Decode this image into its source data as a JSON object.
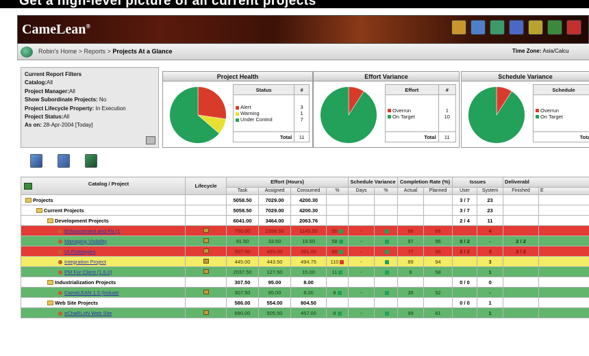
{
  "caption": "Get a high-level picture of all current projects",
  "app": {
    "logo": "CameLean",
    "logo_mark": "®"
  },
  "toolbar_icons": [
    "report-icon",
    "globe-icon",
    "eye-icon",
    "network-icon",
    "gear-icon",
    "shield-icon",
    "help-icon"
  ],
  "toolbar_colors": [
    "#c9962e",
    "#4f7fc9",
    "#3f9a6a",
    "#4a68c4",
    "#b8a22e",
    "#3b8a3b",
    "#c43030"
  ],
  "nav": {
    "crumbs": [
      "Robin's Home",
      "Reports",
      "Projects At a Glance"
    ],
    "separator": ">",
    "timezone_label": "Time Zone:",
    "timezone_value": "Asia/Calcu"
  },
  "filters": {
    "title": "Current Report Filters",
    "rows": [
      {
        "label": "Catalog:",
        "value": "All"
      },
      {
        "label": "Project Manager:",
        "value": "All"
      },
      {
        "label": "Show Subordinate Projects:",
        "value": "No"
      },
      {
        "label": "Project Lifecycle Property:",
        "value": "In Execution"
      },
      {
        "label": "Project Status:",
        "value": "All"
      }
    ],
    "asof_label": "As on:",
    "asof_value": "28-Apr-2004 [Today]"
  },
  "project_health": {
    "title": "Project Health",
    "col_label": "Status",
    "col_count": "#",
    "legend": [
      {
        "label": "Alert",
        "color": "#d93b2b",
        "count": "3"
      },
      {
        "label": "Warning",
        "color": "#e7e030",
        "count": "1"
      },
      {
        "label": "Under Control",
        "color": "#23a05a",
        "count": "7"
      }
    ],
    "total_label": "Total",
    "total": "11"
  },
  "effort_variance": {
    "title": "Effort Variance",
    "col_label": "Effort",
    "col_count": "#",
    "legend": [
      {
        "label": "Overrun",
        "color": "#d93b2b",
        "count": "1"
      },
      {
        "label": "On Target",
        "color": "#23a05a",
        "count": "10"
      }
    ],
    "total_label": "Total",
    "total": "11"
  },
  "schedule_variance": {
    "title": "Schedule Variance",
    "col_label": "Schedule",
    "legend": [
      {
        "label": "Overrun",
        "color": "#d93b2b"
      },
      {
        "label": "On Target",
        "color": "#23a05a"
      }
    ],
    "total_label": "Total"
  },
  "chart_data": [
    {
      "type": "pie",
      "title": "Project Health",
      "labels": [
        "Alert",
        "Warning",
        "Under Control"
      ],
      "values": [
        3,
        1,
        7
      ],
      "colors": [
        "#d93b2b",
        "#e7e030",
        "#23a05a"
      ]
    },
    {
      "type": "pie",
      "title": "Effort Variance",
      "labels": [
        "Overrun",
        "On Target"
      ],
      "values": [
        1,
        10
      ],
      "colors": [
        "#d93b2b",
        "#23a05a"
      ]
    },
    {
      "type": "pie",
      "title": "Schedule Variance",
      "labels": [
        "Overrun",
        "On Target"
      ],
      "values": [
        1,
        10
      ],
      "colors": [
        "#d93b2b",
        "#23a05a"
      ]
    }
  ],
  "grid": {
    "headers": {
      "catalog": "Catalog / Project",
      "lifecycle": "Lifecycle",
      "effort": "Effort (Hours)",
      "schedule": "Schedule Variance",
      "completion": "Completion Rate (%)",
      "issues": "Issues",
      "deliverables": "Deliverabl"
    },
    "subheaders": [
      "Task",
      "Assigned",
      "Consumed",
      "%",
      "Days",
      "%",
      "Actual",
      "Planned",
      "User",
      "System",
      "Finished",
      "E"
    ],
    "rows": [
      {
        "name": "Projects",
        "level": 0,
        "kind": "folder",
        "color": "white",
        "bold": true,
        "task": "5058.50",
        "assigned": "7029.00",
        "consumed": "4200.30",
        "issues_user": "3 / 7",
        "issues_system": "23"
      },
      {
        "name": "Current Projects",
        "level": 1,
        "kind": "folder",
        "color": "white",
        "bold": true,
        "task": "5058.50",
        "assigned": "7029.00",
        "consumed": "4200.30",
        "issues_user": "3 / 7",
        "issues_system": "23"
      },
      {
        "name": "Development Projects",
        "level": 2,
        "kind": "folder",
        "color": "white",
        "bold": true,
        "task": "6041.00",
        "assigned": "3464.00",
        "consumed": "2063.76",
        "issues_user": "2 / 4",
        "issues_system": "11"
      },
      {
        "name": "Enhancement and Fix (1",
        "level": 3,
        "kind": "project",
        "color": "red",
        "task": "750.00",
        "assigned": "2398.50",
        "consumed": "1145.50",
        "pct": "50",
        "pct_sq": "#23a05a",
        "sv_days": "-",
        "sv_sq": "#23a05a",
        "actual": "66",
        "planned": "66",
        "issues_system": "4"
      },
      {
        "name": "Managing Visibility",
        "level": 3,
        "kind": "project",
        "color": "green",
        "task": "91.50",
        "assigned": "33.50",
        "consumed": "19.50",
        "pct": "58",
        "pct_sq": "#23a05a",
        "sv_days": "-",
        "sv_sq": "#23a05a",
        "actual": "97",
        "planned": "96",
        "issues_user": "0 / 2",
        "issues_system": "-",
        "fin": "2 / 2"
      },
      {
        "name": "UI Prototypes",
        "level": 3,
        "kind": "project",
        "color": "red",
        "task": "507.00",
        "assigned": "493.00",
        "consumed": "391.00",
        "pct": "89",
        "pct_sq": "#23a05a",
        "sv_days": "-",
        "sv_sq": "#23a05a",
        "actual": "77",
        "planned": "96",
        "issues_user": "2 / 2",
        "issues_system": "3",
        "fin": "2 / 2"
      },
      {
        "name": "Integration Project",
        "level": 3,
        "kind": "project",
        "color": "yellow",
        "task": "445.00",
        "assigned": "443.50",
        "consumed": "494.75",
        "pct": "110",
        "pct_sq": "#d93b2b",
        "sv_days": "-",
        "sv_sq": "#23a05a",
        "actual": "89",
        "planned": "94",
        "issues_system": "3"
      },
      {
        "name": "PM For Client (1.6.0)",
        "level": 3,
        "kind": "project",
        "color": "green",
        "task": "2037.50",
        "assigned": "127.50",
        "consumed": "15.00",
        "pct": "11",
        "pct_sq": "#23a05a",
        "sv_days": "-",
        "sv_sq": "#23a05a",
        "actual": "8",
        "planned": "58",
        "issues_system": "1"
      },
      {
        "name": "Industrialization Projects",
        "level": 2,
        "kind": "folder",
        "color": "white",
        "bold": true,
        "task": "307.50",
        "assigned": "95.00",
        "consumed": "8.00",
        "issues_user": "0 / 0",
        "issues_system": "0"
      },
      {
        "name": "CameLEAN 1.5 (Industr",
        "level": 3,
        "kind": "project",
        "color": "green",
        "task": "307.50",
        "assigned": "95.00",
        "consumed": "8.00",
        "pct": "8",
        "pct_sq": "#23a05a",
        "sv_days": "-",
        "sv_sq": "#23a05a",
        "actual": "35",
        "planned": "52",
        "issues_system": "-"
      },
      {
        "name": "Web Site Projects",
        "level": 2,
        "kind": "folder",
        "color": "white",
        "bold": true,
        "task": "586.00",
        "assigned": "554.00",
        "consumed": "804.50",
        "issues_user": "0 / 0",
        "issues_system": "1"
      },
      {
        "name": "eChaRLoN Web Site",
        "level": 3,
        "kind": "project",
        "color": "green",
        "task": "690.00",
        "assigned": "505.50",
        "consumed": "457.00",
        "pct": "8",
        "pct_sq": "#23a05a",
        "sv_days": "-",
        "sv_sq": "#23a05a",
        "actual": "99",
        "planned": "81",
        "issues_system": "1"
      }
    ]
  }
}
